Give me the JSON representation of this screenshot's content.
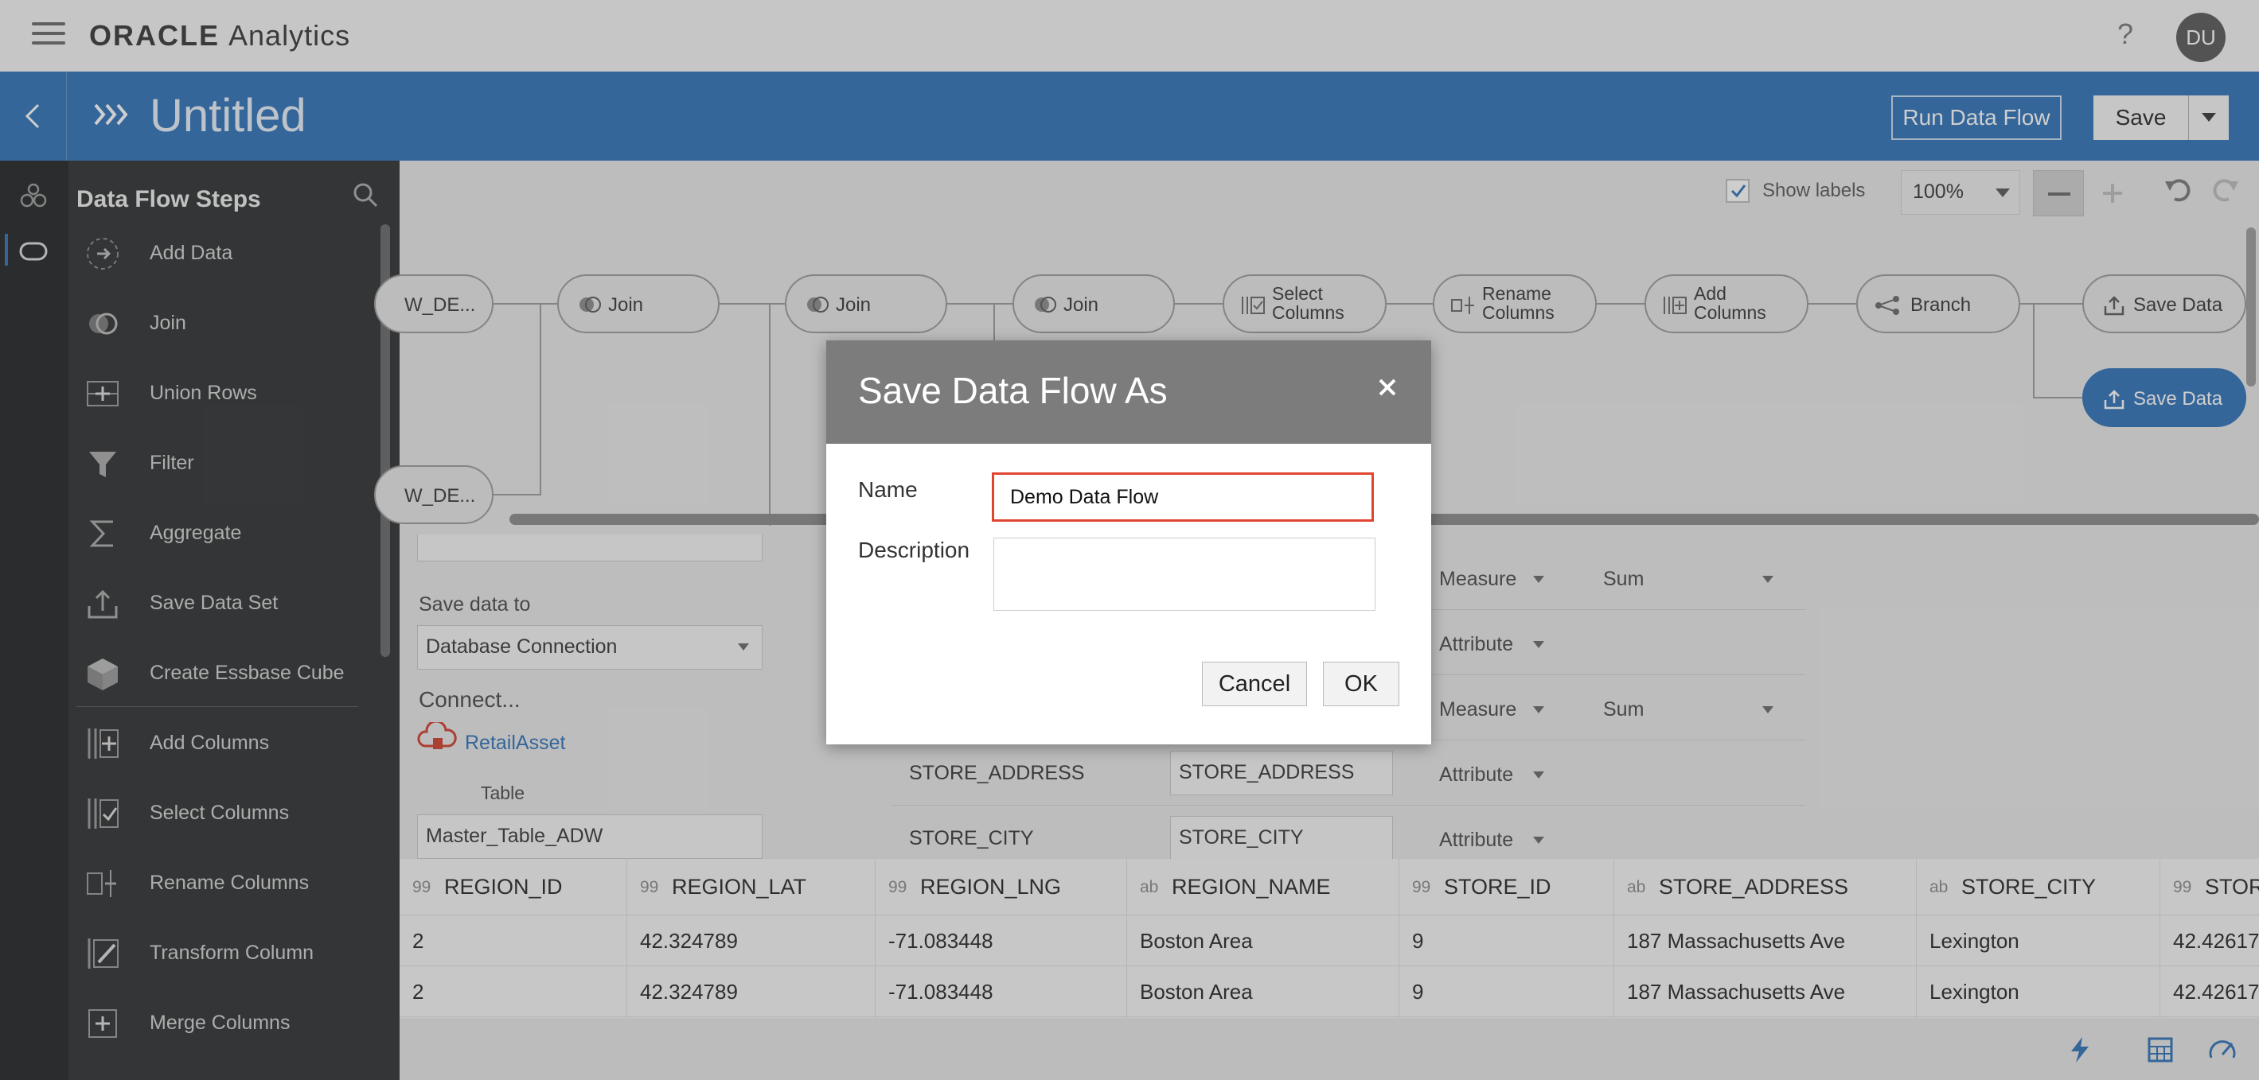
{
  "app": {
    "brand_oracle": "ORACLE",
    "brand_product": "Analytics",
    "user_initials": "DU",
    "help_glyph": "?"
  },
  "header": {
    "title": "Untitled",
    "run_label": "Run Data Flow",
    "save_label": "Save"
  },
  "steps_panel": {
    "title": "Data Flow Steps",
    "items": [
      {
        "label": "Add Data",
        "icon": "add-data-icon"
      },
      {
        "label": "Join",
        "icon": "join-icon"
      },
      {
        "label": "Union Rows",
        "icon": "union-rows-icon"
      },
      {
        "label": "Filter",
        "icon": "filter-icon"
      },
      {
        "label": "Aggregate",
        "icon": "sigma-icon"
      },
      {
        "label": "Save Data Set",
        "icon": "upload-icon"
      },
      {
        "label": "Create Essbase Cube",
        "icon": "cube-icon"
      },
      {
        "label": "Add Columns",
        "icon": "add-columns-icon"
      },
      {
        "label": "Select Columns",
        "icon": "select-columns-icon"
      },
      {
        "label": "Rename Columns",
        "icon": "rename-columns-icon"
      },
      {
        "label": "Transform Column",
        "icon": "transform-column-icon"
      },
      {
        "label": "Merge Columns",
        "icon": "merge-columns-icon"
      }
    ]
  },
  "canvas": {
    "show_labels": "Show labels",
    "zoom": "100%",
    "nodes": {
      "src1": "W_DE...",
      "src2": "W_DE...",
      "join1": "Join",
      "join2": "Join",
      "join3": "Join",
      "select_cols": [
        "Select",
        "Columns"
      ],
      "rename_cols": [
        "Rename",
        "Columns"
      ],
      "add_cols": [
        "Add",
        "Columns"
      ],
      "branch": "Branch",
      "save1": "Save Data",
      "save2": "Save Data"
    }
  },
  "config": {
    "save_data_to_label": "Save data to",
    "save_data_to_value": "Database Connection",
    "connect_label": "Connect...",
    "connection_name": "RetailAsset",
    "table_label": "Table",
    "table_value": "Master_Table_ADW",
    "rows": [
      {
        "name": "",
        "alias": "",
        "treat_as": "Measure",
        "agg": "Sum"
      },
      {
        "name": "",
        "alias": "",
        "treat_as": "Attribute",
        "agg": ""
      },
      {
        "name": "",
        "alias": "",
        "treat_as": "Measure",
        "agg": "Sum"
      },
      {
        "name": "STORE_ADDRESS",
        "alias": "STORE_ADDRESS",
        "treat_as": "Attribute",
        "agg": ""
      },
      {
        "name": "STORE_CITY",
        "alias": "STORE_CITY",
        "treat_as": "Attribute",
        "agg": ""
      }
    ]
  },
  "grid": {
    "columns": [
      {
        "type": "99",
        "name": "REGION_ID"
      },
      {
        "type": "99",
        "name": "REGION_LAT"
      },
      {
        "type": "99",
        "name": "REGION_LNG"
      },
      {
        "type": "ab",
        "name": "REGION_NAME"
      },
      {
        "type": "99",
        "name": "STORE_ID"
      },
      {
        "type": "ab",
        "name": "STORE_ADDRESS"
      },
      {
        "type": "ab",
        "name": "STORE_CITY"
      },
      {
        "type": "99",
        "name": "STOR"
      }
    ],
    "rows": [
      [
        "2",
        "42.324789",
        "-71.083448",
        "Boston Area",
        "9",
        "187 Massachusetts Ave",
        "Lexington",
        "42.42617"
      ],
      [
        "2",
        "42.324789",
        "-71.083448",
        "Boston Area",
        "9",
        "187 Massachusetts Ave",
        "Lexington",
        "42.42617"
      ]
    ]
  },
  "dialog": {
    "title": "Save Data Flow As",
    "close_glyph": "×",
    "name_label": "Name",
    "name_value": "Demo Data Flow",
    "description_label": "Description",
    "description_value": "",
    "cancel_label": "Cancel",
    "ok_label": "OK"
  },
  "colors": {
    "accent": "#2a70b8",
    "highlight": "#e0452f",
    "dialog_header": "#7c7c7c",
    "panel_dark": "#2a2c2d"
  }
}
